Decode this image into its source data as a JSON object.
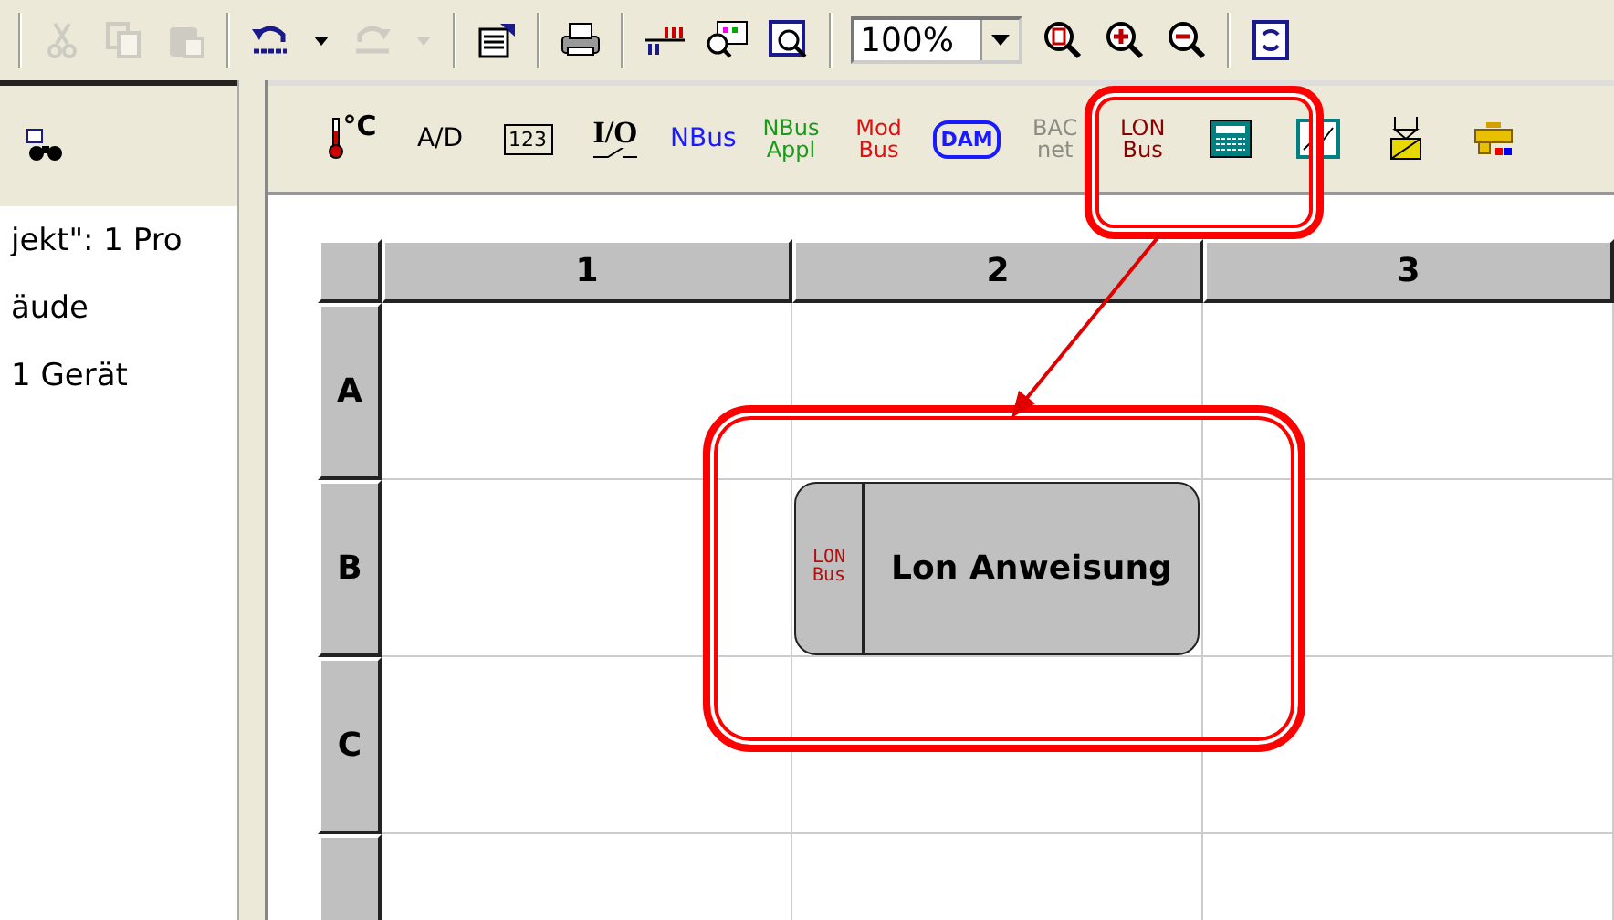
{
  "main_toolbar": {
    "buttons": [
      {
        "disabled": true
      },
      {
        "disabled": true
      },
      {
        "disabled": true
      },
      {
        "disabled": false
      },
      {
        "disabled": false
      },
      {
        "disabled": true
      },
      {
        "disabled": true
      },
      {
        "disabled": false
      },
      {
        "disabled": false
      },
      {
        "disabled": false
      },
      {
        "disabled": false
      },
      {
        "disabled": false
      }
    ],
    "zoom": {
      "value": "100%"
    }
  },
  "sidebar": {
    "items": [
      {
        "label": "jekt\": 1 Pro"
      },
      {
        "label": "äude"
      },
      {
        "label": "1 Gerät"
      }
    ]
  },
  "element_toolbar": {
    "tools": [
      {
        "kind": "thermo",
        "lines": [
          "°C"
        ],
        "disabled": false
      },
      {
        "kind": "text",
        "lines": [
          "A/D"
        ],
        "color": "#000000",
        "disabled": false
      },
      {
        "kind": "boxed",
        "lines": [
          "123"
        ],
        "disabled": false
      },
      {
        "kind": "switch",
        "lines": [
          "I/O"
        ],
        "disabled": false
      },
      {
        "kind": "text",
        "lines": [
          "NBus"
        ],
        "color": "#1a1aff",
        "disabled": false
      },
      {
        "kind": "text",
        "lines": [
          "NBus",
          "Appl"
        ],
        "color": "#1a9a1a",
        "disabled": false
      },
      {
        "kind": "text",
        "lines": [
          "Mod",
          "Bus"
        ],
        "color": "#e01010",
        "disabled": false
      },
      {
        "kind": "chip",
        "lines": [
          "DAM"
        ],
        "disabled": false
      },
      {
        "kind": "text",
        "lines": [
          "BAC",
          "net"
        ],
        "disabled": true
      },
      {
        "kind": "text",
        "lines": [
          "LON",
          "Bus"
        ],
        "color": "#8b0000",
        "disabled": false
      },
      {
        "kind": "calculator",
        "disabled": false
      },
      {
        "kind": "chart",
        "disabled": false
      },
      {
        "kind": "valve",
        "disabled": false
      },
      {
        "kind": "tap",
        "disabled": false
      }
    ]
  },
  "grid": {
    "columns": [
      "1",
      "2",
      "3"
    ],
    "rows": [
      "A",
      "B",
      "C",
      ""
    ]
  },
  "node": {
    "icon_lines": [
      "LON",
      "Bus"
    ],
    "label": "Lon Anweisung"
  }
}
